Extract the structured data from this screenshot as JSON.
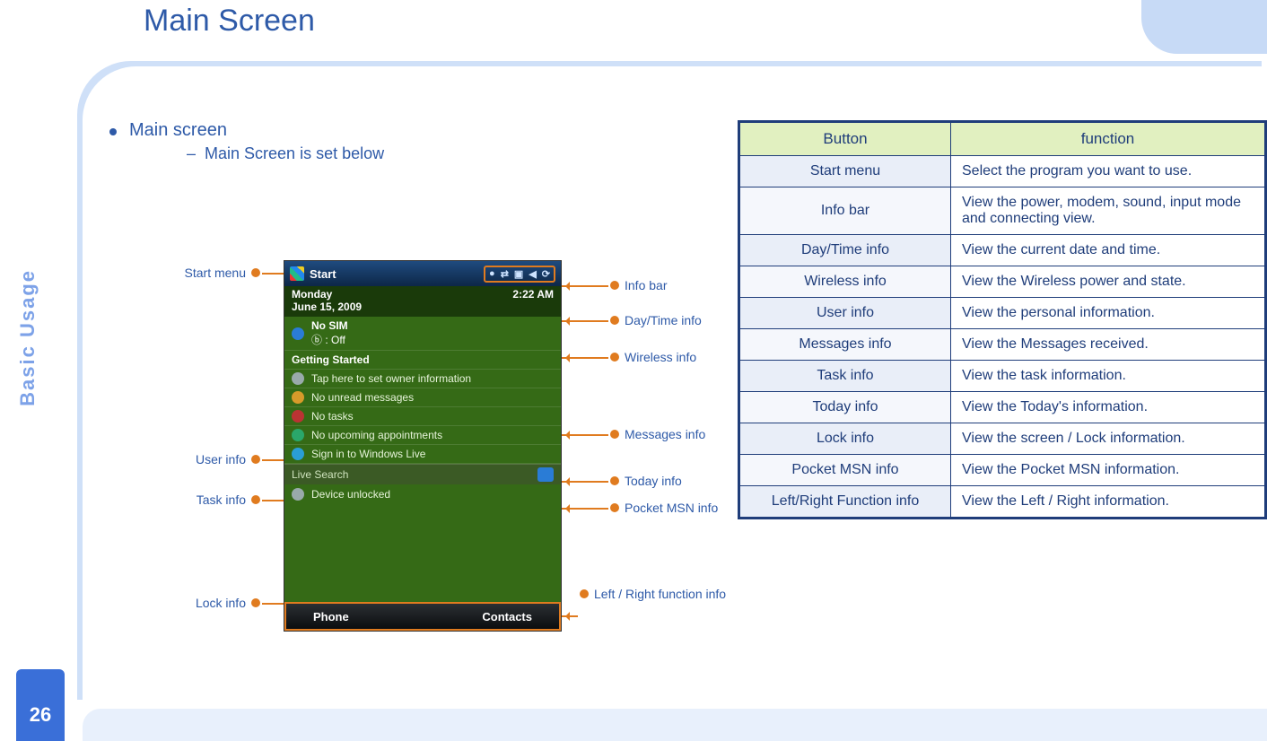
{
  "page_number": "26",
  "side_tab": "Basic Usage",
  "title": "Main Screen",
  "bullet_main": "Main screen",
  "bullet_sub": "Main Screen is set below",
  "phone": {
    "start": "Start",
    "day": "Monday",
    "date": "June 15, 2009",
    "time": "2:22 AM",
    "nosim": "No SIM",
    "bt": " : Off",
    "getting": "Getting Started",
    "owner": "Tap here to set owner information",
    "unread": "No unread messages",
    "tasks": "No tasks",
    "appts": "No upcoming appointments",
    "live": "Sign in to Windows Live",
    "search": "Live Search",
    "unlock": "Device unlocked",
    "soft_left": "Phone",
    "soft_right": "Contacts"
  },
  "callouts": {
    "start_menu": "Start menu",
    "user_info": "User info",
    "task_info": "Task info",
    "lock_info": "Lock info",
    "info_bar": "Info bar",
    "day_time": "Day/Time info",
    "wireless": "Wireless info",
    "messages": "Messages info",
    "today": "Today info",
    "msn": "Pocket MSN info",
    "lr": "Left / Right function info"
  },
  "table_headers": {
    "button": "Button",
    "function": "function"
  },
  "table_rows": [
    {
      "k": "Start menu",
      "v": "Select the program you want to use."
    },
    {
      "k": "Info bar",
      "v": "View the power, modem, sound, input mode and connecting view."
    },
    {
      "k": "Day/Time info",
      "v": "View the current date and time."
    },
    {
      "k": "Wireless info",
      "v": "View the Wireless power and state."
    },
    {
      "k": "User info",
      "v": "View the personal information."
    },
    {
      "k": "Messages info",
      "v": "View the Messages received."
    },
    {
      "k": "Task info",
      "v": "View the task information."
    },
    {
      "k": "Today info",
      "v": "View the Today's information."
    },
    {
      "k": "Lock info",
      "v": "View the screen / Lock information."
    },
    {
      "k": "Pocket MSN info",
      "v": "View the Pocket MSN information."
    },
    {
      "k": "Left/Right Function info",
      "v": "View the Left / Right information."
    }
  ]
}
